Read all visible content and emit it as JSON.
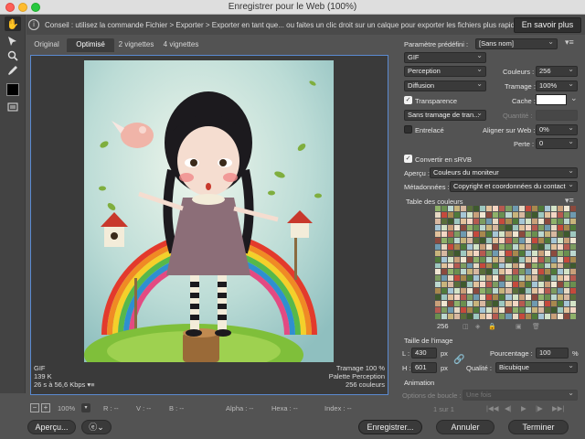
{
  "window": {
    "title": "Enregistrer pour le Web (100%)"
  },
  "tip": {
    "text": "Conseil : utilisez la commande Fichier > Exporter > Exporter en tant que... ou faites un clic droit sur un calque pour exporter les fichiers plus rapidement.",
    "learn_more": "En savoir plus"
  },
  "tabs": [
    "Original",
    "Optimisé",
    "2 vignettes",
    "4 vignettes"
  ],
  "preview_info": {
    "format": "GIF",
    "size": "139 K",
    "time": "26 s à 56,6 Kbps",
    "dither": "Tramage 100 %",
    "palette": "Palette Perception",
    "colors": "256 couleurs"
  },
  "status": {
    "zoom": "100%",
    "r": "R : --",
    "v": "V : --",
    "b": "B : --",
    "alpha": "Alpha : --",
    "hexa": "Hexa : --",
    "index": "Index : --"
  },
  "bottom": {
    "preview": "Aperçu...",
    "save": "Enregistrer...",
    "cancel": "Annuler",
    "done": "Terminer"
  },
  "settings": {
    "preset_label": "Paramètre prédéfini :",
    "preset_value": "[Sans nom]",
    "format": "GIF",
    "reduction": "Perception",
    "colors_label": "Couleurs :",
    "colors_value": "256",
    "dither_algo": "Diffusion",
    "dither_label": "Tramage :",
    "dither_value": "100%",
    "transparency": "Transparence",
    "matte_label": "Cache :",
    "transp_dither": "Sans tramage de tran...",
    "amount_label": "Quantité :",
    "interlaced": "Entrelacé",
    "websnap_label": "Aligner sur Web :",
    "websnap_value": "0%",
    "lossy_label": "Perte :",
    "lossy_value": "0",
    "srgb": "Convertir en sRVB",
    "preview_label": "Aperçu :",
    "preview_value": "Couleurs du moniteur",
    "metadata_label": "Métadonnées :",
    "metadata_value": "Copyright et coordonnées du contact"
  },
  "color_table": {
    "title": "Table des couleurs",
    "count": "256",
    "colors": [
      "#8fb16a",
      "#c9a07a",
      "#4f7a3a",
      "#e7d9c4",
      "#b65a50",
      "#9ec8c0",
      "#d8b8a0",
      "#6a8f4f",
      "#f0e6d2",
      "#a6c6d6",
      "#c54a3c",
      "#7d9c60",
      "#e2c29c",
      "#5a6e3a",
      "#bcd8d0",
      "#8c4a3e",
      "#d4e4c8",
      "#a8884e",
      "#6f9ab0",
      "#f4d6c4",
      "#3e5a2e",
      "#c8b47c"
    ]
  },
  "image_size": {
    "title": "Taille de l’image",
    "w_label": "L :",
    "w_value": "430",
    "h_label": "H :",
    "h_value": "601",
    "unit": "px",
    "percent_label": "Pourcentage :",
    "percent_value": "100",
    "percent_unit": "%",
    "quality_label": "Qualité :",
    "quality_value": "Bicubique"
  },
  "animation": {
    "title": "Animation",
    "loop_label": "Options de boucle :",
    "loop_value": "Une fois",
    "frame": "1 sur 1"
  }
}
